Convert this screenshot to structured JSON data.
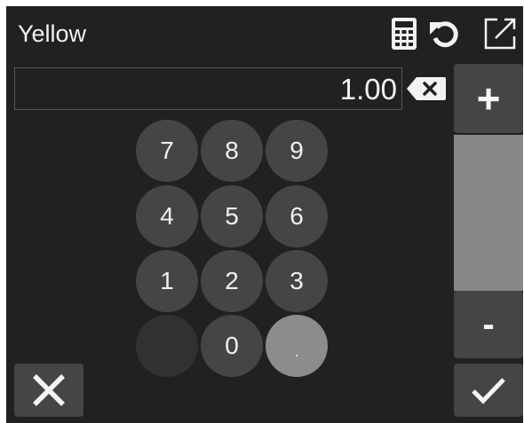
{
  "header": {
    "title": "Yellow",
    "icons": [
      "calculator-icon",
      "undo-icon",
      "open-external-icon"
    ]
  },
  "display": {
    "value": "1.00"
  },
  "keypad": {
    "k7": "7",
    "k8": "8",
    "k9": "9",
    "k4": "4",
    "k5": "5",
    "k6": "6",
    "k1": "1",
    "k2": "2",
    "k3": "3",
    "k0": "0",
    "kdot": "."
  },
  "side": {
    "plus": "+",
    "minus": "-"
  },
  "footer": {
    "cancel_icon": "close-icon",
    "confirm_icon": "check-icon"
  },
  "colors": {
    "background": "#202122",
    "key": "#444547",
    "key_blank": "#303133",
    "key_dot": "#8b8c8e",
    "slider_track": "#868788",
    "text": "#f2f2f2"
  }
}
